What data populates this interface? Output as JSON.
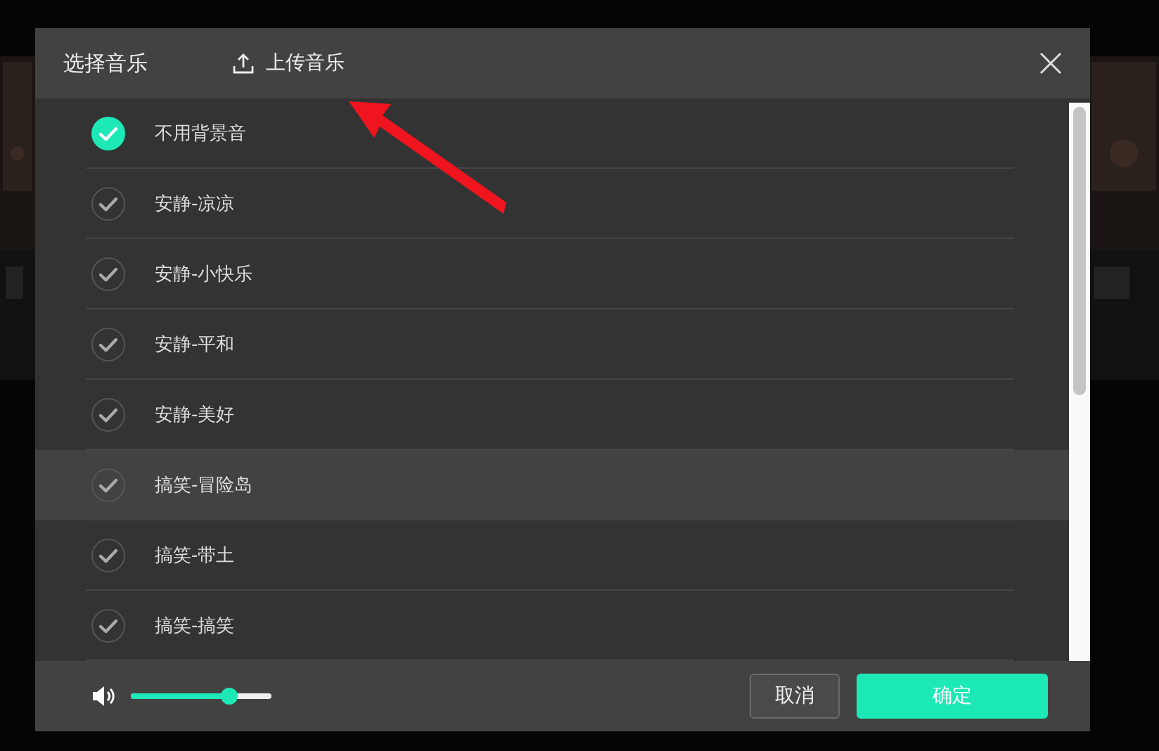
{
  "dialog": {
    "title": "选择音乐",
    "upload_label": "上传音乐"
  },
  "tracks": [
    {
      "name": "不用背景音",
      "selected": true,
      "highlighted": false
    },
    {
      "name": "安静-凉凉",
      "selected": false,
      "highlighted": false
    },
    {
      "name": "安静-小快乐",
      "selected": false,
      "highlighted": false
    },
    {
      "name": "安静-平和",
      "selected": false,
      "highlighted": false
    },
    {
      "name": "安静-美好",
      "selected": false,
      "highlighted": false
    },
    {
      "name": "搞笑-冒险岛",
      "selected": false,
      "highlighted": true
    },
    {
      "name": "搞笑-带土",
      "selected": false,
      "highlighted": false
    },
    {
      "name": "搞笑-搞笑",
      "selected": false,
      "highlighted": false
    }
  ],
  "volume": {
    "level": 0.7
  },
  "buttons": [
    {
      "label": "取消",
      "kind": "secondary"
    },
    {
      "label": "确定",
      "kind": "primary"
    }
  ]
}
